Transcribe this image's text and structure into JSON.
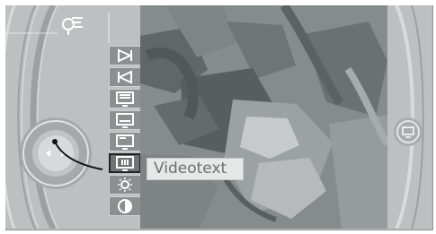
{
  "tooltip": {
    "label": "Videotext"
  },
  "icons": {
    "top": "audio-settings-icon",
    "controller": "controller-knob-icon",
    "right": "tv-icon"
  },
  "menu": [
    {
      "name": "next-track-button",
      "icon": "next-icon",
      "active": false
    },
    {
      "name": "previous-track-button",
      "icon": "previous-icon",
      "active": false
    },
    {
      "name": "screen-option-1-button",
      "icon": "screen-icon",
      "active": false
    },
    {
      "name": "screen-option-2-button",
      "icon": "screen-icon",
      "active": false
    },
    {
      "name": "screen-option-3-button",
      "icon": "screen-icon",
      "active": false
    },
    {
      "name": "videotext-button",
      "icon": "videotext-icon",
      "active": true
    },
    {
      "name": "brightness-button",
      "icon": "brightness-icon",
      "active": false
    },
    {
      "name": "contrast-button",
      "icon": "contrast-icon",
      "active": false
    }
  ],
  "colors": {
    "panel": "#b9bcbd",
    "button": "#8b8f90",
    "active_button": "#707475",
    "label_bg": "#e6e7e7",
    "label_text": "#6d6f70"
  }
}
